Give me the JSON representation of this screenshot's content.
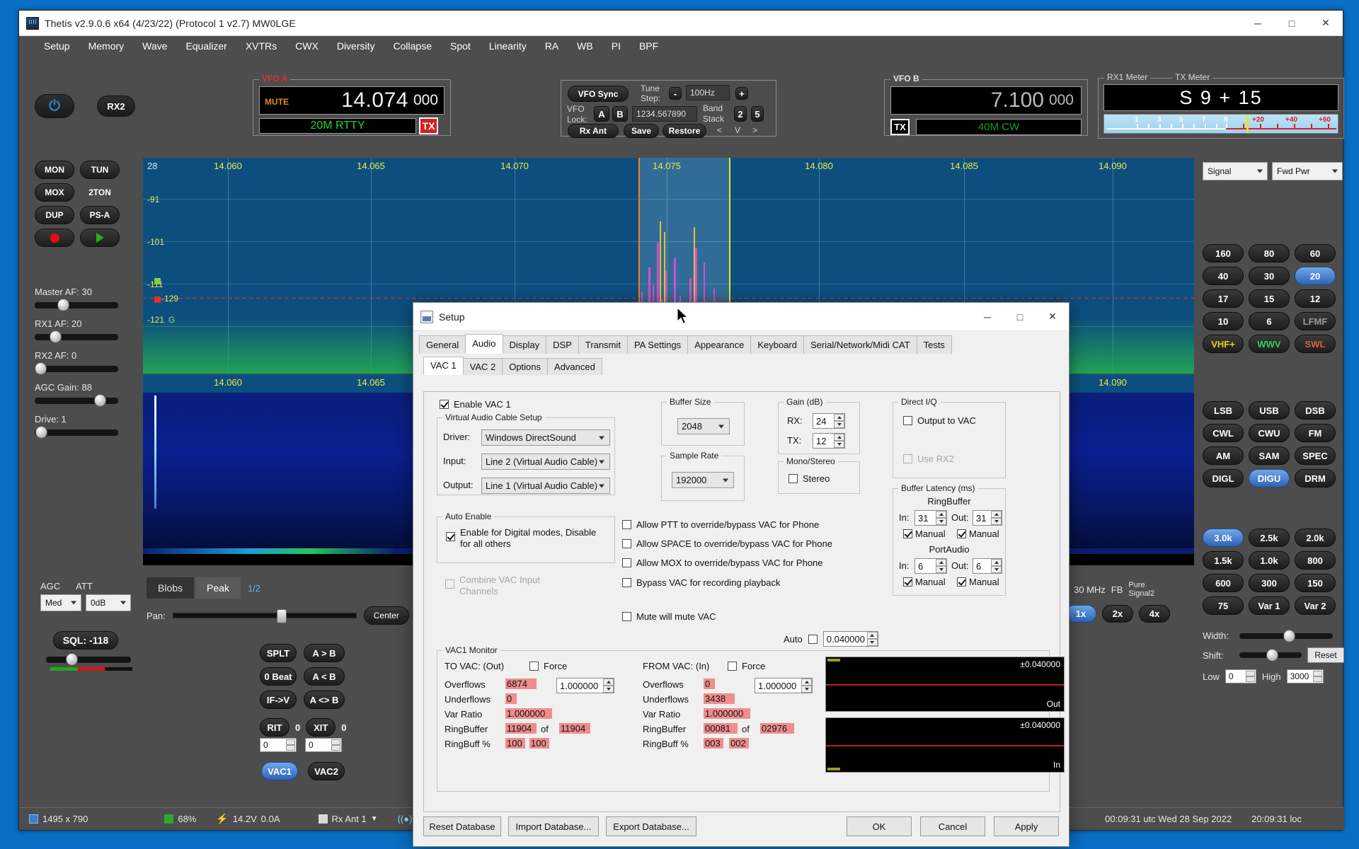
{
  "window": {
    "title": "Thetis v2.9.0.6 x64 (4/23/22) (Protocol 1 v2.7) MW0LGE",
    "minimize": "─",
    "maximize": "□",
    "close": "✕"
  },
  "menu": [
    "Setup",
    "Memory",
    "Wave",
    "Equalizer",
    "XVTRs",
    "CWX",
    "Diversity",
    "Collapse",
    "Spot",
    "Linearity",
    "RA",
    "WB",
    "PI",
    "BPF"
  ],
  "power": {
    "glyph": "⏻",
    "rx2": "RX2"
  },
  "vfo_a": {
    "group": "VFO A",
    "mute": "MUTE",
    "freq_main": "14.074",
    "freq_sub": "000",
    "mode": "20M RTTY",
    "tx": "TX"
  },
  "vfo_b": {
    "group": "VFO B",
    "freq_main": "7.100",
    "freq_sub": "000",
    "mode": "40M CW",
    "tx": "TX"
  },
  "sync_panel": {
    "vfo_sync": "VFO Sync",
    "tune_step_label": "Tune Step:",
    "minus": "-",
    "tune_step": "100Hz",
    "plus": "+",
    "vfo_lock_label": "VFO Lock:",
    "a": "A",
    "b": "B",
    "freq_entry": "1234.567890",
    "band_stack_label": "Band Stack",
    "stack2": "2",
    "stack5": "5",
    "rx_ant": "Rx Ant",
    "save": "Save",
    "restore": "Restore",
    "prev": "<",
    "down": "V",
    "next": ">"
  },
  "meter": {
    "rx_label": "RX1 Meter",
    "tx_label": "TX Meter",
    "reading": "S 9 + 15",
    "scale_numbers": [
      "1",
      "3",
      "5",
      "7",
      "9"
    ],
    "scale_red": [
      "+20",
      "+40",
      "+60"
    ],
    "select_signal": "Signal",
    "select_power": "Fwd Pwr"
  },
  "left_controls": {
    "buttons": [
      "MON",
      "TUN",
      "MOX",
      "2TON",
      "DUP",
      "PS-A"
    ],
    "record": "record-button",
    "play": "play-button",
    "sliders": [
      {
        "label": "Master AF: 30",
        "pct": 30
      },
      {
        "label": "RX1 AF: 20",
        "pct": 20
      },
      {
        "label": "RX2 AF: 0",
        "pct": 0
      },
      {
        "label": "AGC Gain: 88",
        "pct": 88
      },
      {
        "label": "Drive: 1",
        "pct": 1
      }
    ],
    "agc_label": "AGC",
    "agc_value": "Med",
    "att_label": "ATT",
    "att_value": "0dB",
    "sql_label": "SQL: -118"
  },
  "panadapter": {
    "top_left": "28",
    "freq_ticks": [
      "14.060",
      "14.065",
      "14.070",
      "14.075",
      "14.080",
      "14.085",
      "14.090"
    ],
    "db_ticks": [
      "-91",
      "-101",
      "-111",
      "-121"
    ],
    "marker_value": "-129"
  },
  "waterfall": {
    "freq_ticks": [
      "14.060",
      "14.065",
      "14.090"
    ]
  },
  "display_tabs": {
    "blobs": "Blobs",
    "peak": "Peak",
    "half": "1/2",
    "pan_label": "Pan:",
    "center": "Center"
  },
  "zoom_row": {
    "mhz": "30 MHz",
    "fb": "FB",
    "pure": "Pure Signal2",
    "z1": "1x",
    "z2": "2x",
    "z4": "4x"
  },
  "split_buttons": [
    "SPLT",
    "A > B",
    "0 Beat",
    "A < B",
    "IF->V",
    "A <> B"
  ],
  "rit_xit": {
    "rit": "RIT",
    "rit_val": "0",
    "xit": "XIT",
    "xit_val": "0",
    "n1": "0",
    "n2": "0"
  },
  "vac_buttons": {
    "vac1": "VAC1",
    "vac2": "VAC2"
  },
  "bands": [
    [
      "160",
      "80",
      "60"
    ],
    [
      "40",
      "30",
      "20"
    ],
    [
      "17",
      "15",
      "12"
    ],
    [
      "10",
      "6",
      "LFMF"
    ],
    [
      "VHF+",
      "WWV",
      "SWL"
    ]
  ],
  "selected_band": "20",
  "modes": [
    [
      "LSB",
      "USB",
      "DSB"
    ],
    [
      "CWL",
      "CWU",
      "FM"
    ],
    [
      "AM",
      "SAM",
      "SPEC"
    ],
    [
      "DIGL",
      "DIGU",
      "DRM"
    ]
  ],
  "selected_mode": "DIGU",
  "filters": [
    [
      "3.0k",
      "2.5k",
      "2.0k"
    ],
    [
      "1.5k",
      "1.0k",
      "800"
    ],
    [
      "600",
      "300",
      "150"
    ],
    [
      "75",
      "Var 1",
      "Var 2"
    ]
  ],
  "selected_filter": "3.0k",
  "width_shift": {
    "width_label": "Width:",
    "shift_label": "Shift:",
    "reset": "Reset",
    "low_label": "Low",
    "low_value": "0",
    "high_label": "High",
    "high_value": "3000"
  },
  "statusbar": {
    "resolution": "1495 x 790",
    "cpu": "68%",
    "voltage": "14.2V",
    "current": "0.0A",
    "antenna": "Rx Ant 1",
    "utc_time": "00:09:31 utc Wed 28 Sep 2022",
    "local_time": "20:09:31 loc"
  },
  "setup": {
    "title": "Setup",
    "minimize": "─",
    "maximize": "□",
    "close": "✕",
    "tabs_main": [
      "General",
      "Audio",
      "Display",
      "DSP",
      "Transmit",
      "PA Settings",
      "Appearance",
      "Keyboard",
      "Serial/Network/Midi CAT",
      "Tests"
    ],
    "tabs_main_active": "Audio",
    "tabs_sub": [
      "VAC 1",
      "VAC 2",
      "Options",
      "Advanced"
    ],
    "tabs_sub_active": "VAC 1",
    "enable_vac1": "Enable VAC 1",
    "vac_setup": {
      "group": "Virtual Audio Cable Setup",
      "driver_label": "Driver:",
      "driver_value": "Windows DirectSound",
      "input_label": "Input:",
      "input_value": "Line 2 (Virtual Audio Cable)",
      "output_label": "Output:",
      "output_value": "Line 1 (Virtual Audio Cable)"
    },
    "buffer_size": {
      "group": "Buffer Size",
      "value": "2048"
    },
    "sample_rate": {
      "group": "Sample Rate",
      "value": "192000"
    },
    "gain": {
      "group": "Gain (dB)",
      "rx_label": "RX:",
      "rx_value": "24",
      "tx_label": "TX:",
      "tx_value": "12"
    },
    "mono_stereo": {
      "group": "Mono/Stereo",
      "stereo": "Stereo"
    },
    "direct_iq": {
      "group": "Direct I/Q",
      "output_to_vac": "Output to VAC",
      "use_rx2": "Use RX2"
    },
    "buffer_latency": {
      "group": "Buffer Latency (ms)",
      "ring_title": "RingBuffer",
      "ring_in_label": "In:",
      "ring_in_value": "31",
      "ring_out_label": "Out:",
      "ring_out_value": "31",
      "ring_in_manual": "Manual",
      "ring_out_manual": "Manual",
      "port_title": "PortAudio",
      "port_in_label": "In:",
      "port_in_value": "6",
      "port_out_label": "Out:",
      "port_out_value": "6",
      "port_in_manual": "Manual",
      "port_out_manual": "Manual"
    },
    "auto_enable": {
      "group": "Auto Enable",
      "checkbox": "Enable for Digital modes, Disable for all others"
    },
    "combine_vac": "Combine VAC Input Channels",
    "override_options": [
      "Allow PTT to override/bypass VAC for Phone",
      "Allow SPACE to override/bypass VAC for Phone",
      "Allow MOX to override/bypass VAC for Phone",
      "Bypass VAC for recording playback"
    ],
    "mute_will_mute": "Mute will mute VAC",
    "auto_label": "Auto",
    "auto_value": "0.040000",
    "monitor": {
      "group": "VAC1 Monitor",
      "out": {
        "title": "TO VAC: (Out)",
        "force": "Force",
        "ratio": "1.000000",
        "overflows_label": "Overflows",
        "overflows": "6874",
        "underflows_label": "Underflows",
        "underflows": "0",
        "var_ratio_label": "Var Ratio",
        "var_ratio": "1.000000",
        "ringbuffer_label": "RingBuffer",
        "ringbuffer": "11904",
        "of": "of",
        "ringbuffer_max": "11904",
        "ringbuff_pct_label": "RingBuff %",
        "pct1": "100",
        "pct2": "100"
      },
      "in": {
        "title": "FROM VAC: (In)",
        "force": "Force",
        "ratio": "1.000000",
        "overflows_label": "Overflows",
        "overflows": "0",
        "underflows_label": "Underflows",
        "underflows": "3438",
        "var_ratio_label": "Var Ratio",
        "var_ratio": "1.000000",
        "ringbuffer_label": "RingBuffer",
        "ringbuffer": "00081",
        "of": "of",
        "ringbuffer_max": "02976",
        "ringbuff_pct_label": "RingBuff %",
        "pct1": "003",
        "pct2": "002"
      },
      "graph_out": {
        "range": "±0.040000",
        "label": "Out"
      },
      "graph_in": {
        "range": "±0.040000",
        "label": "In"
      }
    },
    "footer": {
      "reset_db": "Reset Database",
      "import_db": "Import Database...",
      "export_db": "Export Database...",
      "ok": "OK",
      "cancel": "Cancel",
      "apply": "Apply"
    }
  }
}
